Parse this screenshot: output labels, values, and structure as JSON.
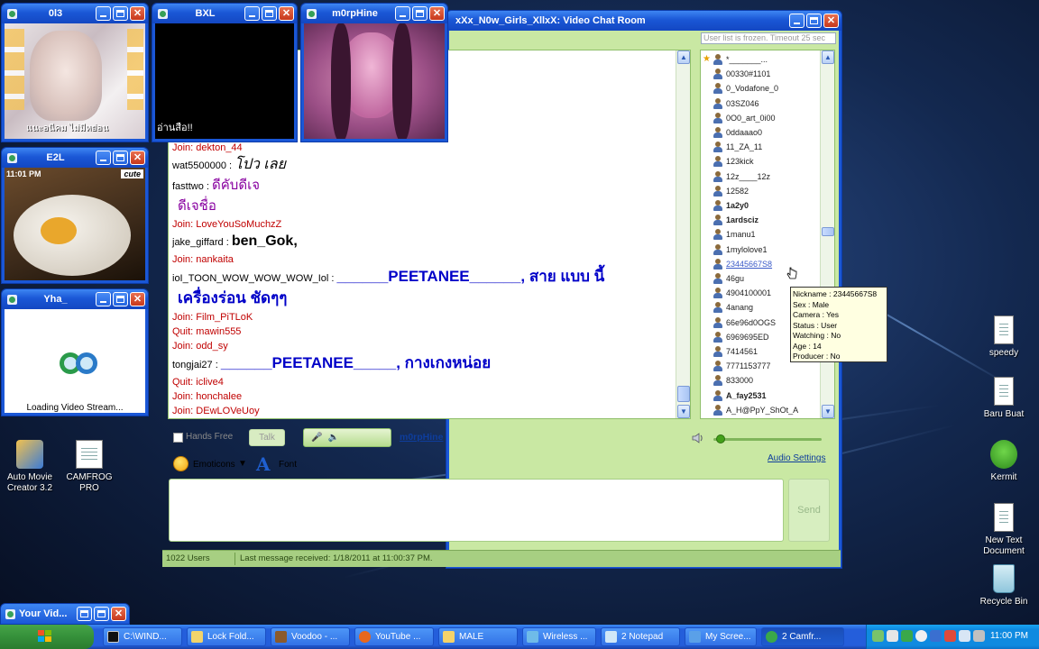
{
  "chat_window": {
    "title": "xXx_N0w_Girls_XllxX: Video Chat Room",
    "frozen_notice": "User list is frozen. Timeout 25 sec",
    "status_users": "1022 Users",
    "status_last_message": "Last message received: 1/18/2011 at 11:00:37 PM."
  },
  "video_windows": [
    {
      "title": "0l3",
      "overlay_text": "แนะอนีคม ไม่มีหย่อน"
    },
    {
      "title": "BXL",
      "overlay_text": "อ่านสือ!!"
    },
    {
      "title": "m0rpHine",
      "overlay_text": ""
    },
    {
      "title": "E2L",
      "overlay_text": "11:01 PM",
      "badge": "cute"
    },
    {
      "title": "Yha_",
      "overlay_text": "Loading Video Stream..."
    }
  ],
  "chat_lines": [
    {
      "type": "join",
      "text": "Join: dekton_44"
    },
    {
      "type": "msg",
      "nick": "wat5500000 :",
      "msg": "โปว เลย",
      "style": "big"
    },
    {
      "type": "msg",
      "nick": "fasttwo :",
      "msg": "ดีคับดีเจ",
      "style": "purple"
    },
    {
      "type": "cont",
      "msg": "ดีเจชื่อ",
      "style": "purple"
    },
    {
      "type": "join",
      "text": "Join: LoveYouSoMuchzZ"
    },
    {
      "type": "msg",
      "nick": "jake_giffard :",
      "msg": "ben_Gok,",
      "style": "bigbold"
    },
    {
      "type": "join",
      "text": "Join: nankaita"
    },
    {
      "type": "msg",
      "nick": "ioI_TOON_WOW_WOW_WOW_Iol :",
      "msg": "______PEETANEE______, สาย แบบ นี้",
      "style": "blue"
    },
    {
      "type": "cont",
      "msg": "เครื่องร่อน ชัดๆๆ",
      "style": "blue"
    },
    {
      "type": "join",
      "text": "Join: Film_PiTLoK"
    },
    {
      "type": "join",
      "text": "Quit: mawin555"
    },
    {
      "type": "join",
      "text": "Join: odd_sy"
    },
    {
      "type": "msg",
      "nick": "tongjai27 :",
      "msg": "______PEETANEE_____, กางเกงหน่อย",
      "style": "blue"
    },
    {
      "type": "join",
      "text": "Quit: iclive4"
    },
    {
      "type": "join",
      "text": "Join: honchalee"
    },
    {
      "type": "join",
      "text": "Join: DEwLOVeUoy"
    }
  ],
  "users": [
    "*_______...",
    "00330#1101",
    "0_Vodafone_0",
    "03SZ046",
    "0O0_art_0i00",
    "0ddaaao0",
    "11_ZA_11",
    "123kick",
    "12z____12z",
    "12582",
    "1a2y0",
    "1ardsciz",
    "1manu1",
    "1mylolove1",
    "23445667S8",
    "46gu",
    "4904100001",
    "4anang",
    "66e96d0OGS",
    "6969695ED",
    "7414561",
    "7771153777",
    "833000",
    "A_fay2531",
    "A_H@PpY_ShOt_A"
  ],
  "tooltip": [
    "Nickname : 23445667S8",
    "Sex : Male",
    "Camera : Yes",
    "Status : User",
    "Watching : No",
    "Age : 14",
    "Producer : No"
  ],
  "controls": {
    "hands_free": "Hands Free",
    "talk": "Talk",
    "speaker": "m0rpHine",
    "audio_settings": "Audio Settings",
    "emoticons": "Emoticons",
    "font": "Font",
    "send": "Send"
  },
  "desktop_icons": [
    {
      "label": "Auto Movie Creator 3.2"
    },
    {
      "label": "CAMFROG PRO"
    },
    {
      "label": "speedy"
    },
    {
      "label": "Baru Buat"
    },
    {
      "label": "Kermit"
    },
    {
      "label": "New Text Document"
    },
    {
      "label": "Recycle Bin"
    }
  ],
  "minimized_window": {
    "title": "Your Vid..."
  },
  "taskbar": {
    "tasks": [
      {
        "label": "C:\\WIND..."
      },
      {
        "label": "Lock Fold..."
      },
      {
        "label": "Voodoo - ..."
      },
      {
        "label": "YouTube ..."
      },
      {
        "label": "MALE"
      },
      {
        "label": "Wireless ..."
      },
      {
        "label": "2 Notepad"
      },
      {
        "label": "My Scree..."
      },
      {
        "label": "2 Camfr..."
      }
    ],
    "clock": "11:00 PM"
  },
  "colors": {
    "xp_blue": "#1a57d6",
    "chat_green": "#c9e8a3",
    "join_red": "#c00000",
    "msg_blue": "#0000c8"
  }
}
